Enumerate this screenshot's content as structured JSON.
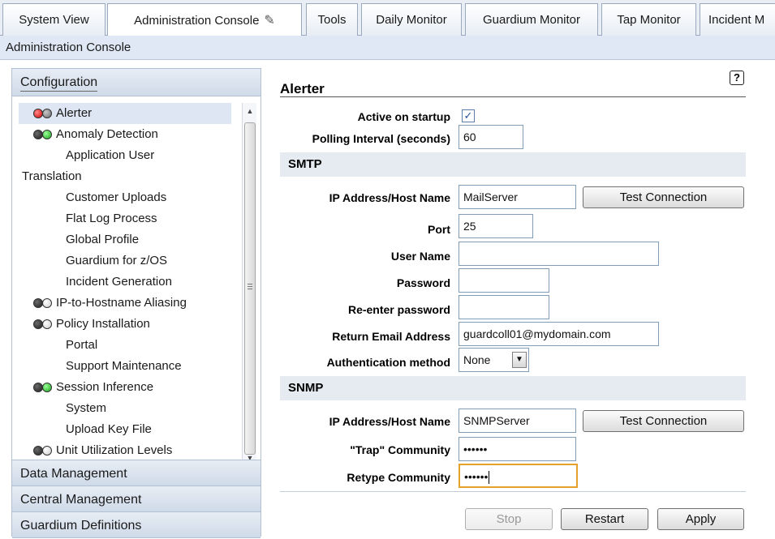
{
  "tabs": [
    {
      "label": "System View"
    },
    {
      "label": "Administration Console"
    },
    {
      "label": "Tools"
    },
    {
      "label": "Daily Monitor"
    },
    {
      "label": "Guardium Monitor"
    },
    {
      "label": "Tap Monitor"
    },
    {
      "label": "Incident M"
    }
  ],
  "breadcrumb": "Administration Console",
  "sidebar": {
    "configuration_header": "Configuration",
    "items": [
      {
        "label": "Alerter",
        "lights": [
          "red",
          "gray"
        ]
      },
      {
        "label": "Anomaly Detection",
        "lights": [
          "dark",
          "green"
        ]
      },
      {
        "label": "Application User",
        "lights": []
      },
      {
        "label": "Translation",
        "lights": []
      },
      {
        "label": "Customer Uploads",
        "lights": []
      },
      {
        "label": "Flat Log Process",
        "lights": []
      },
      {
        "label": "Global Profile",
        "lights": []
      },
      {
        "label": "Guardium for z/OS",
        "lights": []
      },
      {
        "label": "Incident Generation",
        "lights": []
      },
      {
        "label": "IP-to-Hostname Aliasing",
        "lights": [
          "dark",
          "white"
        ]
      },
      {
        "label": "Policy Installation",
        "lights": [
          "dark",
          "white"
        ]
      },
      {
        "label": "Portal",
        "lights": []
      },
      {
        "label": "Support Maintenance",
        "lights": []
      },
      {
        "label": "Session Inference",
        "lights": [
          "dark",
          "green"
        ]
      },
      {
        "label": "System",
        "lights": []
      },
      {
        "label": "Upload Key File",
        "lights": []
      },
      {
        "label": "Unit Utilization Levels",
        "lights": [
          "dark",
          "white"
        ]
      }
    ],
    "data_management": "Data Management",
    "central_management": "Central Management",
    "guardium_definitions": "Guardium Definitions"
  },
  "form": {
    "title": "Alerter",
    "help": "?",
    "active_on_startup_label": "Active on startup",
    "active_on_startup_checked": true,
    "check_mark": "✓",
    "polling_label": "Polling Interval (seconds)",
    "polling_value": "60",
    "smtp": {
      "section": "SMTP",
      "host_label": "IP Address/Host Name",
      "host_value": "MailServer",
      "test_button": "Test Connection",
      "port_label": "Port",
      "port_value": "25",
      "user_label": "User Name",
      "user_value": "",
      "password_label": "Password",
      "password_value": "",
      "reenter_label": "Re-enter password",
      "reenter_value": "",
      "return_email_label": "Return Email Address",
      "return_email_value": "guardcoll01@mydomain.com",
      "auth_label": "Authentication method",
      "auth_value": "None"
    },
    "snmp": {
      "section": "SNMP",
      "host_label": "IP Address/Host Name",
      "host_value": "SNMPServer",
      "test_button": "Test Connection",
      "trap_label": "\"Trap\" Community",
      "trap_value": "••••••",
      "retype_label": "Retype Community",
      "retype_value": "••••••"
    },
    "buttons": {
      "stop": "Stop",
      "restart": "Restart",
      "apply": "Apply"
    }
  }
}
